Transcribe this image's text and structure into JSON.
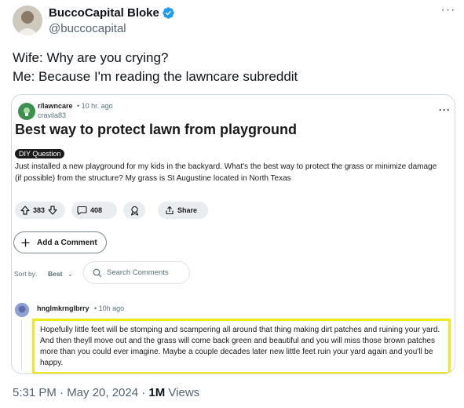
{
  "author": {
    "display_name": "BuccoCapital Bloke",
    "handle": "@buccocapital"
  },
  "tweet": {
    "line1": "Wife: Why are you crying?",
    "line2": "Me: Because I'm reading the lawncare subreddit"
  },
  "post": {
    "subreddit": "r/lawncare",
    "time": "• 10 hr. ago",
    "poster": "cravila83",
    "title": "Best way to protect lawn from playground",
    "flair": "DIY Question",
    "body": "Just installed a new playground for my kids in the backyard. What's the best way to protect the grass or minimize damage (if possible) from the structure? My grass is St Augustine located in North Texas",
    "votes": "383",
    "comments": "408",
    "share_label": "Share",
    "add_comment_label": "Add a Comment",
    "sort_label": "Sort by:",
    "sort_value": "Best",
    "search_placeholder": "Search Comments"
  },
  "comment": {
    "user": "hnglmkrnglbrry",
    "time": "• 10h ago",
    "text": "Hopefully little feet will be stomping and scampering all around that thing making dirt patches and ruining your yard. And then theyll move out and the grass will come back green and beautiful and you will miss those brown patches more than you could ever imagine. Maybe a couple decades later new little feet ruin your yard again and you'll be happy."
  },
  "meta": {
    "timestamp": "5:31 PM · May 20, 2024 · ",
    "views_count": "1M",
    "views_label": " Views"
  },
  "colors": {
    "verified_badge": "#1d9bf0",
    "highlight_border": "#f1e81a",
    "subreddit_icon": "#3c8f4f"
  },
  "icons": [
    "verified-icon",
    "more-icon",
    "upvote-icon",
    "downvote-icon",
    "comment-icon",
    "award-icon",
    "share-icon",
    "plus-icon",
    "chevron-down-icon",
    "search-icon"
  ]
}
